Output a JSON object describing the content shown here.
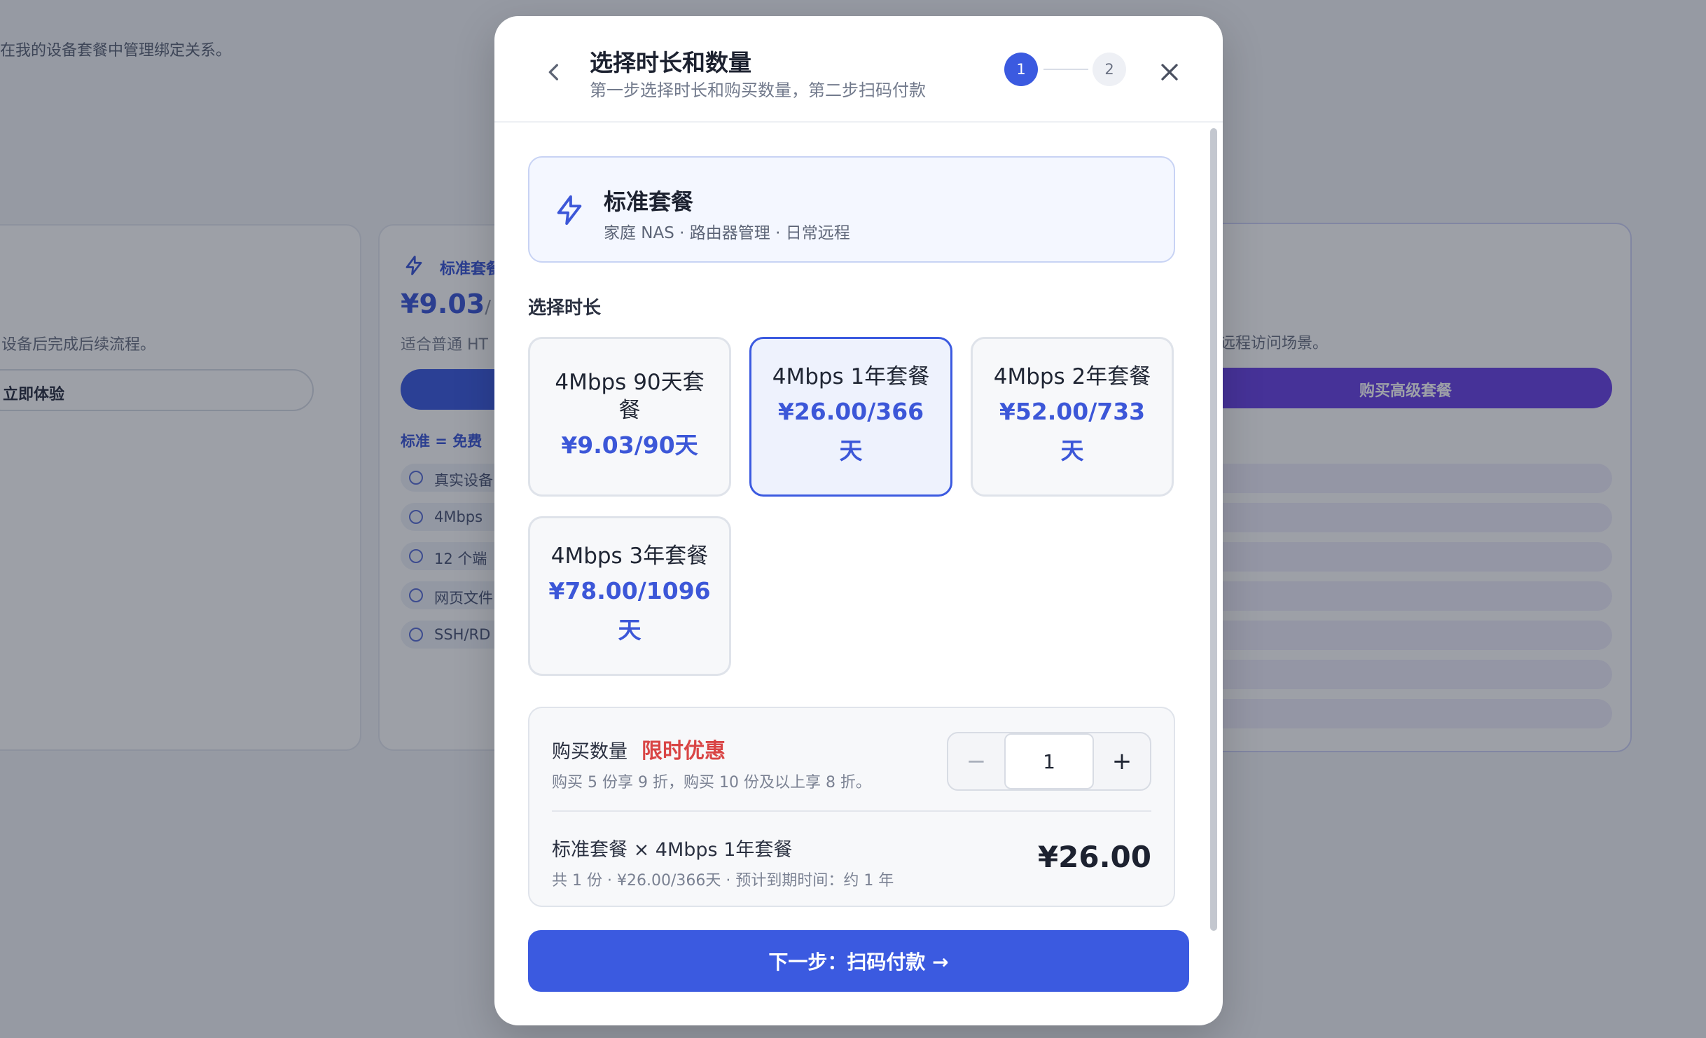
{
  "background": {
    "description": "在我的设备套餐中管理绑定关系。",
    "left_card": {
      "text": "设备后完成后续流程。",
      "button_label": "立即体验"
    },
    "mid_card": {
      "tag": "标准套餐",
      "price": "¥9.03",
      "price_unit": "/",
      "subtitle": "适合普通 HT",
      "note": "标准 = 免费",
      "features": [
        "真实设备",
        "4Mbps",
        "12 个端",
        "网页文件",
        "SSH/RD"
      ]
    },
    "right_card": {
      "text": "远程访问场景。",
      "button_label": "购买高级套餐"
    }
  },
  "modal": {
    "title": "选择时长和数量",
    "subtitle": "第一步选择时长和购买数量，第二步扫码付款",
    "steps": [
      "1",
      "2"
    ],
    "plan": {
      "name": "标准套餐",
      "description": "家庭 NAS · 路由器管理 · 日常远程"
    },
    "duration_label": "选择时长",
    "durations": [
      {
        "name": "4Mbps 90天套餐",
        "price": "¥9.03/90天",
        "selected": false
      },
      {
        "name": "4Mbps 1年套餐",
        "price": "¥26.00/366天",
        "selected": true
      },
      {
        "name": "4Mbps 2年套餐",
        "price": "¥52.00/733天",
        "selected": false
      },
      {
        "name": "4Mbps 3年套餐",
        "price": "¥78.00/1096天",
        "selected": false
      }
    ],
    "quantity": {
      "label": "购买数量",
      "promo": "限时优惠",
      "hint": "购买 5 份享 9 折，购买 10 份及以上享 8 折。",
      "minus": "−",
      "plus": "+",
      "value": "1"
    },
    "summary": {
      "title": "标准套餐 × 4Mbps 1年套餐",
      "detail": "共 1 份 · ¥26.00/366天 · 预计到期时间：约 1 年",
      "total": "¥26.00"
    },
    "next_button": "下一步：扫码付款 →"
  }
}
